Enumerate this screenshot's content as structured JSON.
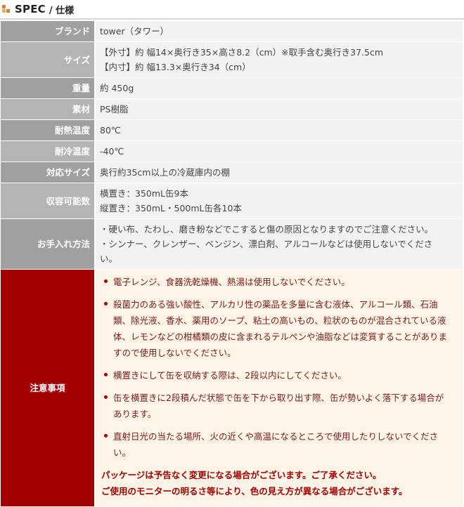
{
  "header": {
    "title": "SPEC",
    "subtitle": "/ 仕様"
  },
  "rows": [
    {
      "label": "ブランド",
      "lines": [
        "tower（タワー）"
      ]
    },
    {
      "label": "サイズ",
      "lines": [
        "【外寸】約 幅14×奥行き35×高さ8.2（cm）※取手含む奥行き37.5cm",
        "【内寸】約 幅13.3×奥行き34（cm）"
      ]
    },
    {
      "label": "重量",
      "lines": [
        "約 450g"
      ]
    },
    {
      "label": "素材",
      "lines": [
        "PS樹脂"
      ]
    },
    {
      "label": "耐熱温度",
      "lines": [
        "80℃"
      ]
    },
    {
      "label": "耐冷温度",
      "lines": [
        "-40℃"
      ]
    },
    {
      "label": "対応サイズ",
      "lines": [
        "奥行約35cm以上の冷蔵庫内の棚"
      ]
    },
    {
      "label": "収容可能数",
      "lines": [
        "横置き：350mL缶9本",
        "縦置き：350mL・500mL缶各10本"
      ]
    },
    {
      "label": "お手入れ方法",
      "lines": [
        "・硬い布、たわし、磨き粉などでこすると傷の原因となりますのでご注意ください。",
        "・シンナー、クレンザー、ベンジン、漂白剤、アルコールなどは使用しないでくださ",
        "い。"
      ]
    }
  ],
  "caution": {
    "label": "注意事項",
    "items": [
      [
        "電子レンジ、食器洗乾燥機、熱湯は使用しないでください。"
      ],
      [
        "殺菌力のある強い酸性、アルカリ性の薬品を多量に含む液体、アルコール類、石油",
        "類、除光液、香水、薬用のソープ、粘土の高いもの、粒状のものが混合されている液",
        "体、レモンなどの柑橘類の皮に含まれるテルペンや油脂などは変質することがありま",
        "すので使用しないでください。"
      ],
      [
        "横置きにして缶を収納する際は、2段以内にしてください。"
      ],
      [
        "缶を横置きに2段積んだ状態で缶を下から取り出す際、缶が勢いよく落下する場合が",
        "あります。"
      ],
      [
        "直射日光の当たる場所、火の近くや高温になるところで使用したりしないでくださ",
        "い。"
      ]
    ],
    "notices": [
      "パッケージは予告なく変更になる場合がございます。ご了承ください。",
      "ご使用のモニターの明るさ等により、色の見え方が異なる場合がございます。"
    ]
  },
  "colors": {
    "label_dark": "#a0a0a0",
    "label_light": "#b4b4b4",
    "caution_label": "#a50000",
    "caution_bg": "#fdf3e6",
    "accent": "#e8811a"
  }
}
